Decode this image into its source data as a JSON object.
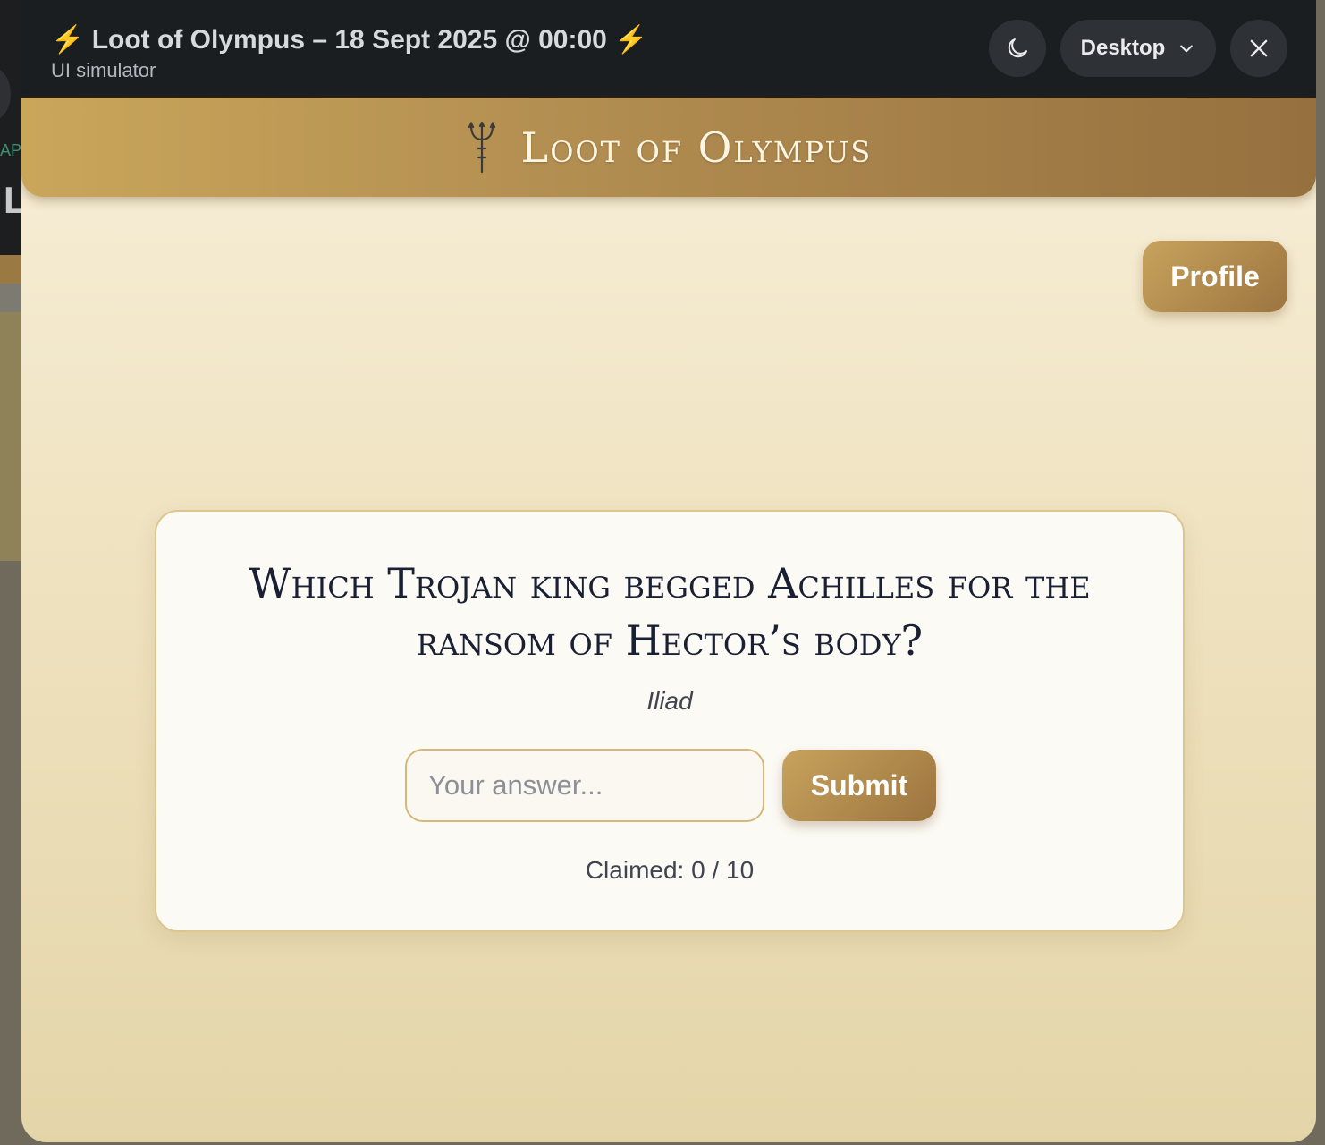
{
  "simulator": {
    "title_bolt_left": "⚡",
    "title_text": "Loot of Olympus – 18 Sept 2025 @ 00:00",
    "title_bolt_right": "⚡",
    "subtitle": "UI simulator",
    "theme_icon": "moon-icon",
    "device_label": "Desktop",
    "device_icon": "chevron-down-icon",
    "close_icon": "close-icon"
  },
  "background_app": {
    "partial_text_1": "AP",
    "partial_text_2": "L"
  },
  "banner": {
    "icon": "trident-icon",
    "title": "Loot of Olympus"
  },
  "profile_button": "Profile",
  "question_card": {
    "question": "Which Trojan king begged Achilles for the ransom of Hector’s body?",
    "source": "Iliad",
    "answer_placeholder": "Your answer...",
    "answer_value": "",
    "submit_label": "Submit",
    "claimed_label": "Claimed: 0 / 10"
  },
  "colors": {
    "gold_light": "#c9a65a",
    "gold_dark": "#96703e",
    "header_dark": "#1b1e21",
    "bolt": "#f2c318",
    "card_bg": "#fcfaf5",
    "text_dark": "#1a2033"
  }
}
